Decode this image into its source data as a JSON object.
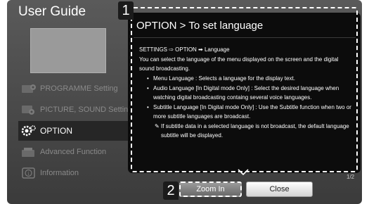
{
  "guide": {
    "title": "User Guide",
    "menu": [
      {
        "label": "PROGRAMME Setting",
        "icon": "tv-settings-icon",
        "active": false
      },
      {
        "label": "PICTURE, SOUND Setting",
        "icon": "picture-sound-icon",
        "active": false
      },
      {
        "label": "OPTION",
        "icon": "gear-icon",
        "active": true
      },
      {
        "label": "Advanced Function",
        "icon": "advanced-function-icon",
        "active": false
      },
      {
        "label": "Information",
        "icon": "info-icon",
        "active": false
      }
    ]
  },
  "annotations": {
    "badge1": "1",
    "badge2": "2"
  },
  "panel": {
    "title": "OPTION > To set language",
    "path": "SETTINGS ⇨ OPTION ➡ Language",
    "intro": "You can select the language of the menu displayed on the screen and the digital sound broadcasting.",
    "bullets": [
      "Menu Language : Selects a language for the display text.",
      "Audio Language [In Digital mode Only] : Select the desired language when watching digital broadcasting containg several voice languages.",
      "Subtitle Language [In Digital mode Only] : Use the Subtitle function when two or more subtitle languages are broadcast."
    ],
    "note_mark": "✎",
    "note": "If subtitle data in a selected language is not broadcast, the default language subtitle will be displayed.",
    "page": "1/2"
  },
  "buttons": {
    "zoom": "Zoom In",
    "close": "Close"
  },
  "colors": {
    "panel_bg": "#0c0c0c",
    "active_item_bg": "#262626",
    "screen_bg": "#4a4a4a"
  }
}
